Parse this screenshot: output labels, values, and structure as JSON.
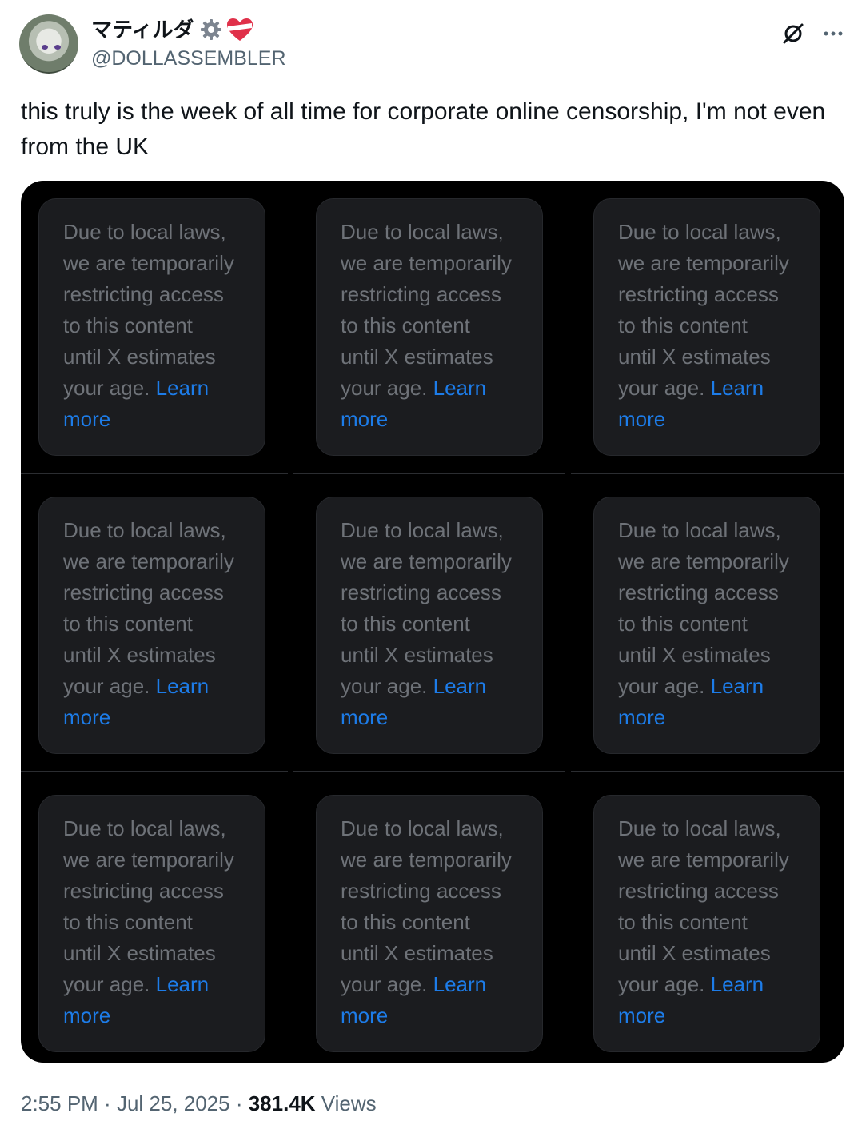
{
  "author": {
    "display_name": "マティルダ",
    "handle": "@DOLLASSEMBLER",
    "badge_icons": [
      "gear-icon",
      "heart-icon"
    ]
  },
  "header_icons": [
    "grok-icon",
    "more-icon"
  ],
  "tweet": {
    "text": "this truly is the week of all time for corporate online censorship, I'm not even from the UK"
  },
  "media": {
    "grid": "3x3",
    "cards": [
      {
        "lines": [
          "Due to local laws,",
          "we are temporarily",
          "restricting access",
          "to this content",
          "until X estimates",
          "your age. "
        ],
        "link_1": "Learn",
        "link_2": "more"
      },
      {
        "lines": [
          "Due to local laws,",
          "we are temporarily",
          "restricting access",
          "to this content",
          "until X estimates",
          "your age. "
        ],
        "link_1": "Learn",
        "link_2": "more"
      },
      {
        "lines": [
          "Due to local laws,",
          "we are temporarily",
          "restricting access",
          "to this content",
          "until X estimates",
          "your age. "
        ],
        "link_1": "Learn",
        "link_2": "more"
      },
      {
        "lines": [
          "Due to local laws,",
          "we are temporarily",
          "restricting access",
          "to this content",
          "until X estimates",
          "your age. "
        ],
        "link_1": "Learn",
        "link_2": "more"
      },
      {
        "lines": [
          "Due to local laws,",
          "we are temporarily",
          "restricting access",
          "to this content",
          "until X estimates",
          "your age. "
        ],
        "link_1": "Learn",
        "link_2": "more"
      },
      {
        "lines": [
          "Due to local laws,",
          "we are temporarily",
          "restricting access",
          "to this content",
          "until X estimates",
          "your age. "
        ],
        "link_1": "Learn",
        "link_2": "more"
      },
      {
        "lines": [
          "Due to local laws,",
          "we are temporarily",
          "restricting access",
          "to this content",
          "until X estimates",
          "your age. "
        ],
        "link_1": "Learn",
        "link_2": "more"
      },
      {
        "lines": [
          "Due to local laws,",
          "we are temporarily",
          "restricting access",
          "to this content",
          "until X estimates",
          "your age. "
        ],
        "link_1": "Learn",
        "link_2": "more"
      },
      {
        "lines": [
          "Due to local laws,",
          "we are temporarily",
          "restricting access",
          "to this content",
          "until X estimates",
          "your age. "
        ],
        "link_1": "Learn",
        "link_2": "more"
      }
    ]
  },
  "footer": {
    "time": "2:55 PM",
    "separator_1": " · ",
    "date": "Jul 25, 2025",
    "separator_2": " · ",
    "views_count": "381.4K",
    "views_label": " Views"
  },
  "colors": {
    "text_primary": "#0f1419",
    "text_secondary": "#536471",
    "card_background": "#1b1c1f",
    "card_text": "#6e7278",
    "link": "#1d7ce8",
    "media_background": "#000000"
  }
}
